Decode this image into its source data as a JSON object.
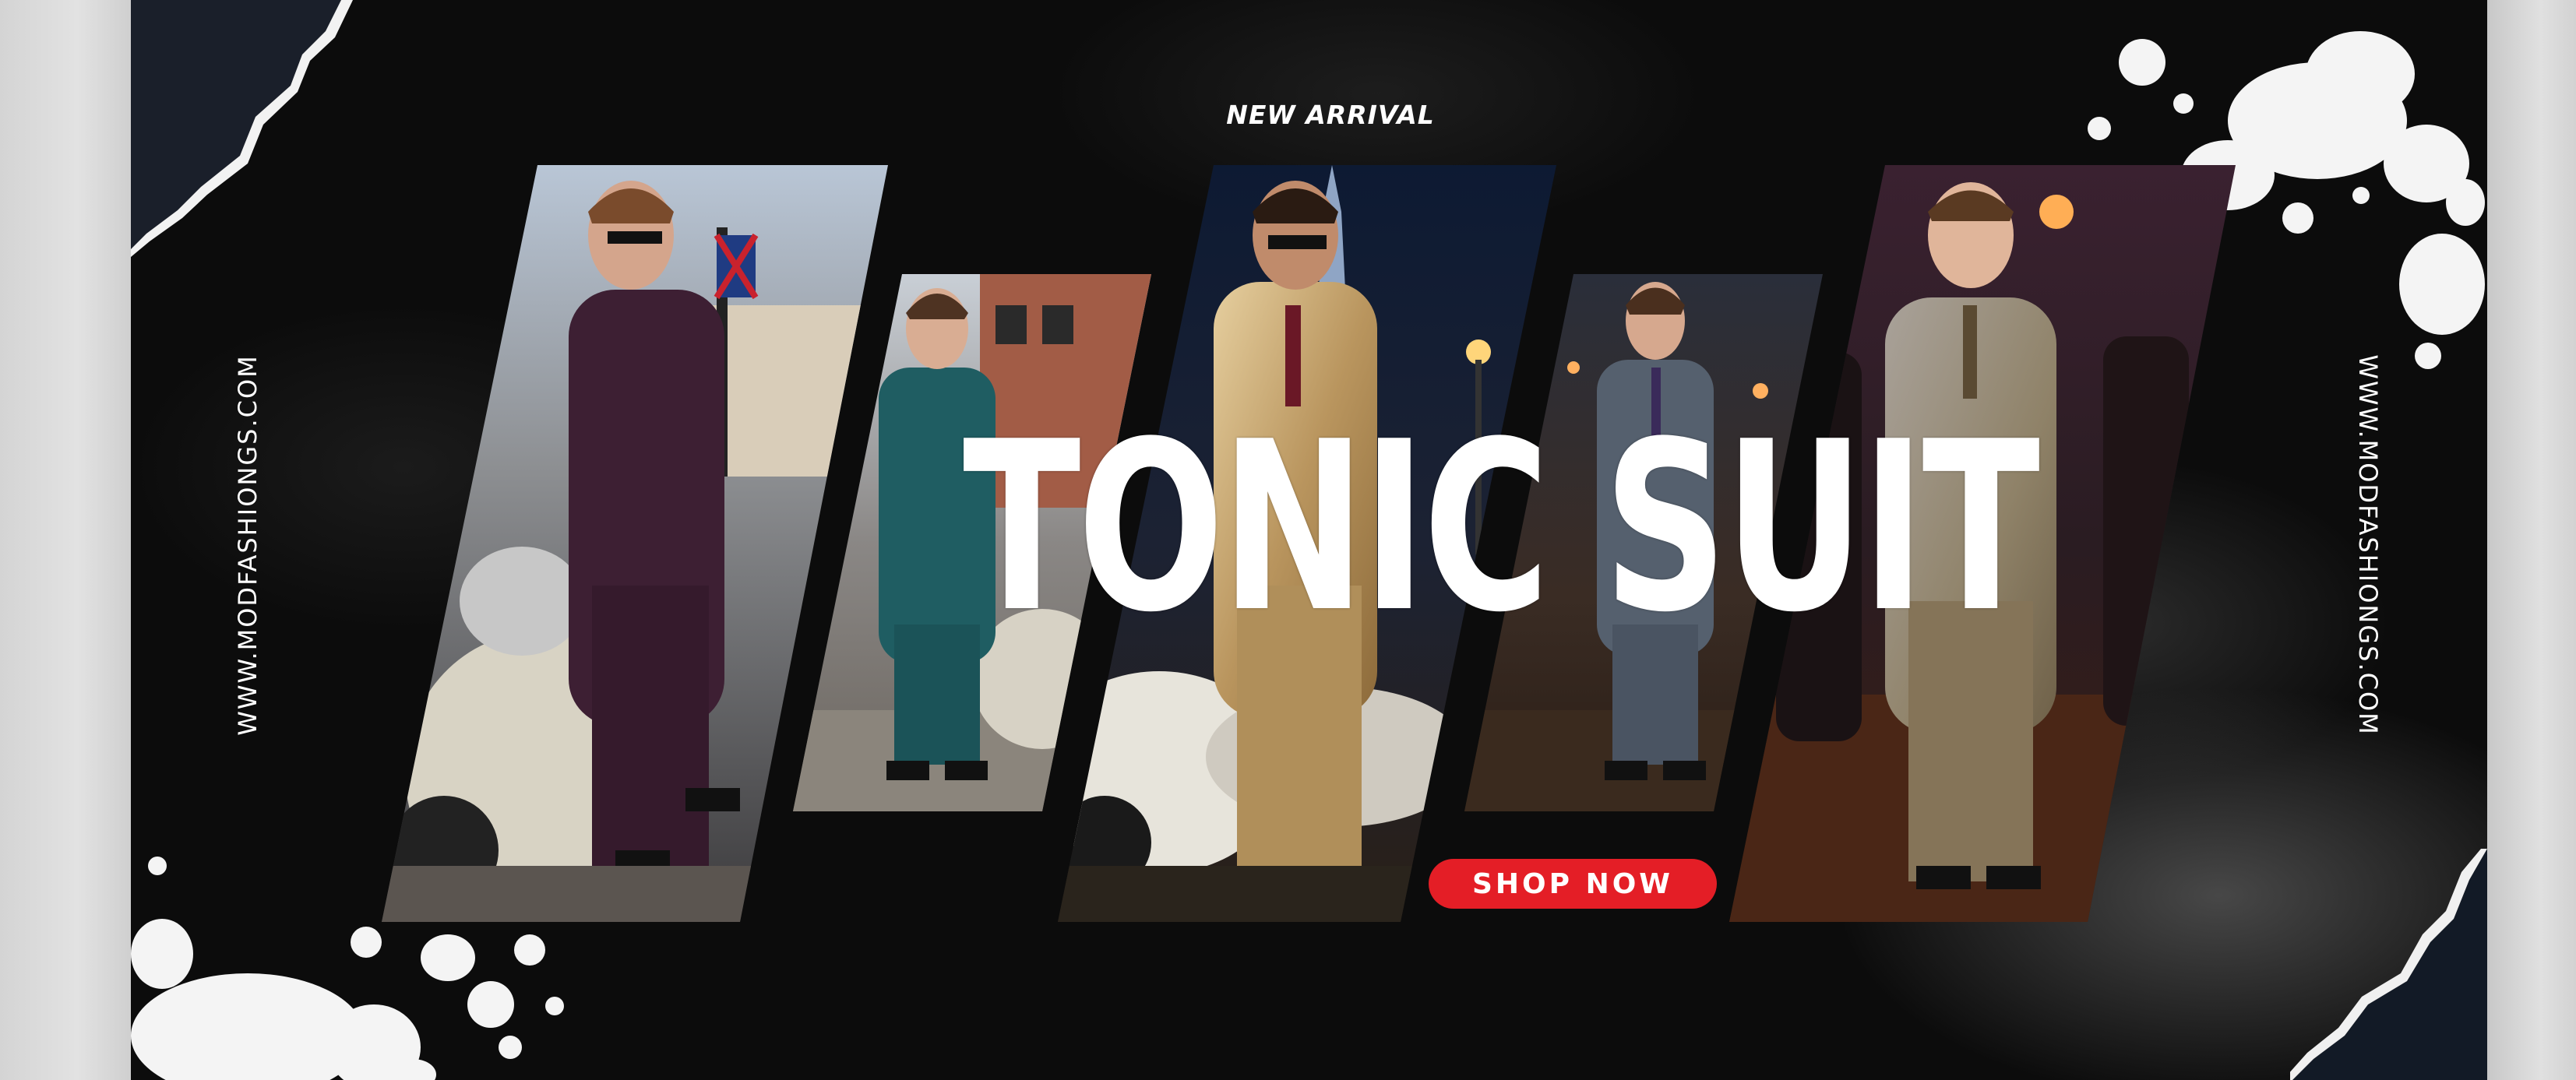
{
  "banner": {
    "eyebrow": "NEW ARRIVAL",
    "headline": "TONIC SUIT",
    "cta_label": "SHOP NOW",
    "side_url_left": "WWW.MODFASHIONGS.COM",
    "side_url_right": "WWW.MODFASHIONGS.COM"
  },
  "colors": {
    "background": "#0c0c0c",
    "accent": "#e41e26",
    "text": "#ffffff"
  },
  "photos": [
    {
      "subject": "man in purple suit leaning on scooter"
    },
    {
      "subject": "man in teal suit on street"
    },
    {
      "subject": "man in gold suit with sunglasses beside scooter"
    },
    {
      "subject": "man in grey suit in bar"
    },
    {
      "subject": "man in champagne suit holding drink"
    }
  ]
}
